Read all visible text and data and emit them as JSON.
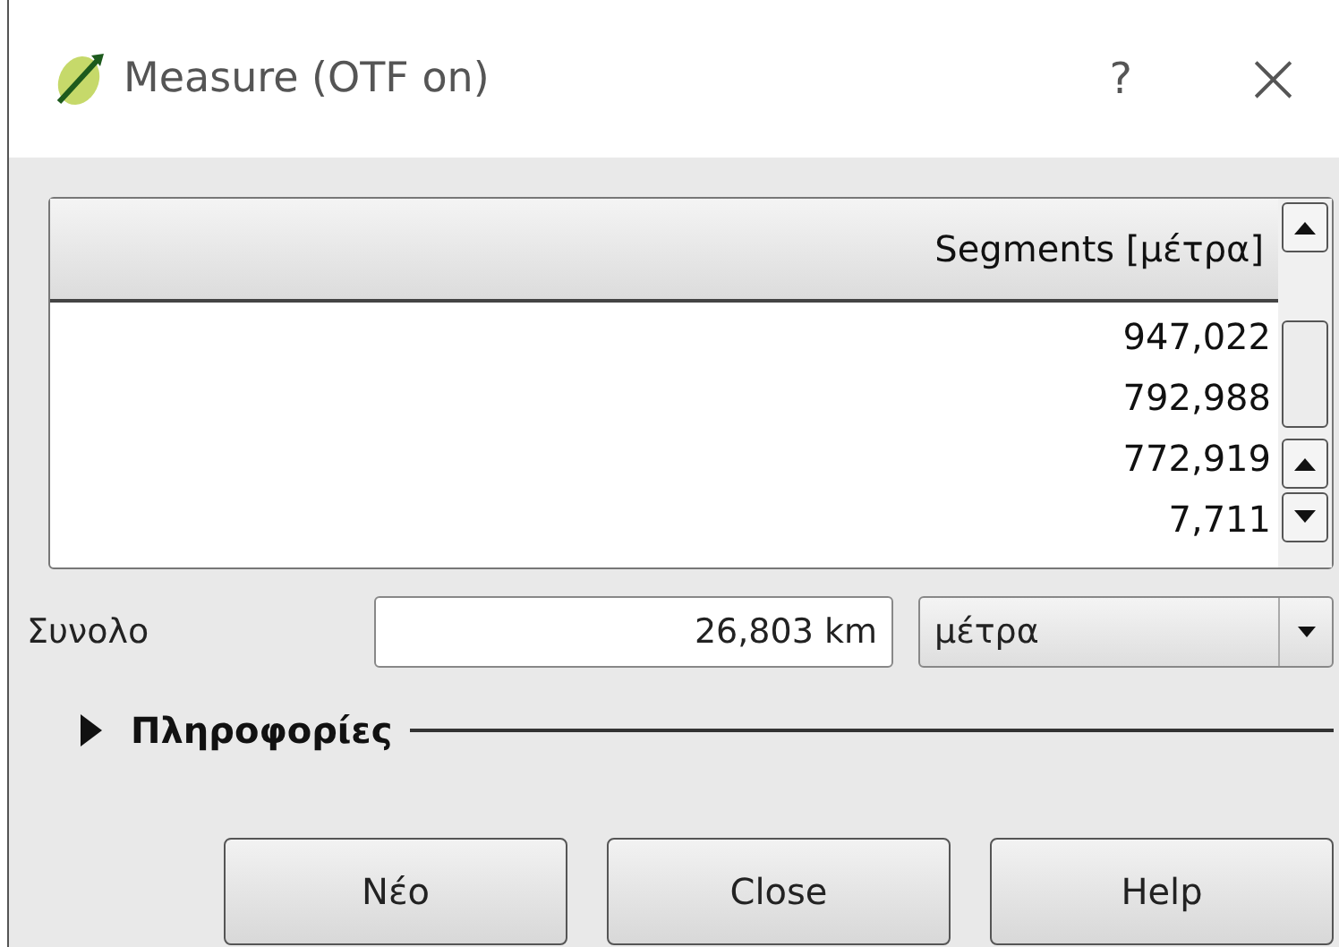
{
  "window": {
    "title": "Measure (OTF on)",
    "help": "?",
    "close": "×"
  },
  "table": {
    "columns": [
      "Segments [μέτρα]"
    ],
    "rows": [
      {
        "value": "947,022"
      },
      {
        "value": "792,988"
      },
      {
        "value": "772,919"
      },
      {
        "value": "7,711"
      }
    ]
  },
  "total": {
    "label": "Συνολο",
    "value": "26,803 km",
    "unit": "μέτρα"
  },
  "info": {
    "label": "Πληροφορίες",
    "expanded": false
  },
  "buttons": [
    "Νέο",
    "Close",
    "Help"
  ]
}
